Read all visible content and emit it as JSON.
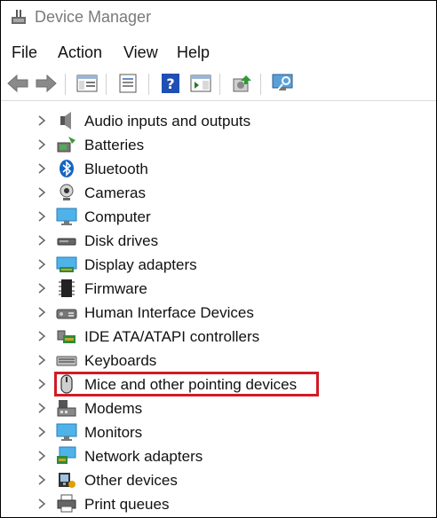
{
  "window": {
    "title": "Device Manager"
  },
  "menu": [
    "File",
    "Action",
    "View",
    "Help"
  ],
  "toolbar": {
    "buttons": [
      "back-arrow-icon",
      "forward-arrow-icon",
      "console-tree-icon",
      "properties-icon",
      "help-icon",
      "action-pane-icon",
      "update-driver-icon",
      "scan-hardware-icon"
    ]
  },
  "tree": {
    "items": [
      {
        "label": "Audio inputs and outputs",
        "icon": "speaker-icon"
      },
      {
        "label": "Batteries",
        "icon": "battery-icon"
      },
      {
        "label": "Bluetooth",
        "icon": "bluetooth-icon"
      },
      {
        "label": "Cameras",
        "icon": "camera-icon"
      },
      {
        "label": "Computer",
        "icon": "computer-icon"
      },
      {
        "label": "Disk drives",
        "icon": "disk-drive-icon"
      },
      {
        "label": "Display adapters",
        "icon": "display-adapter-icon"
      },
      {
        "label": "Firmware",
        "icon": "firmware-chip-icon"
      },
      {
        "label": "Human Interface Devices",
        "icon": "hid-icon"
      },
      {
        "label": "IDE ATA/ATAPI controllers",
        "icon": "ide-controller-icon"
      },
      {
        "label": "Keyboards",
        "icon": "keyboard-icon"
      },
      {
        "label": "Mice and other pointing devices",
        "icon": "mouse-icon",
        "highlighted": true
      },
      {
        "label": "Modems",
        "icon": "modem-icon"
      },
      {
        "label": "Monitors",
        "icon": "monitor-icon"
      },
      {
        "label": "Network adapters",
        "icon": "network-adapter-icon"
      },
      {
        "label": "Other devices",
        "icon": "other-devices-icon"
      },
      {
        "label": "Print queues",
        "icon": "printer-icon"
      }
    ]
  },
  "colors": {
    "highlight_border": "#d11b24",
    "title_text": "#7a7a7a"
  }
}
